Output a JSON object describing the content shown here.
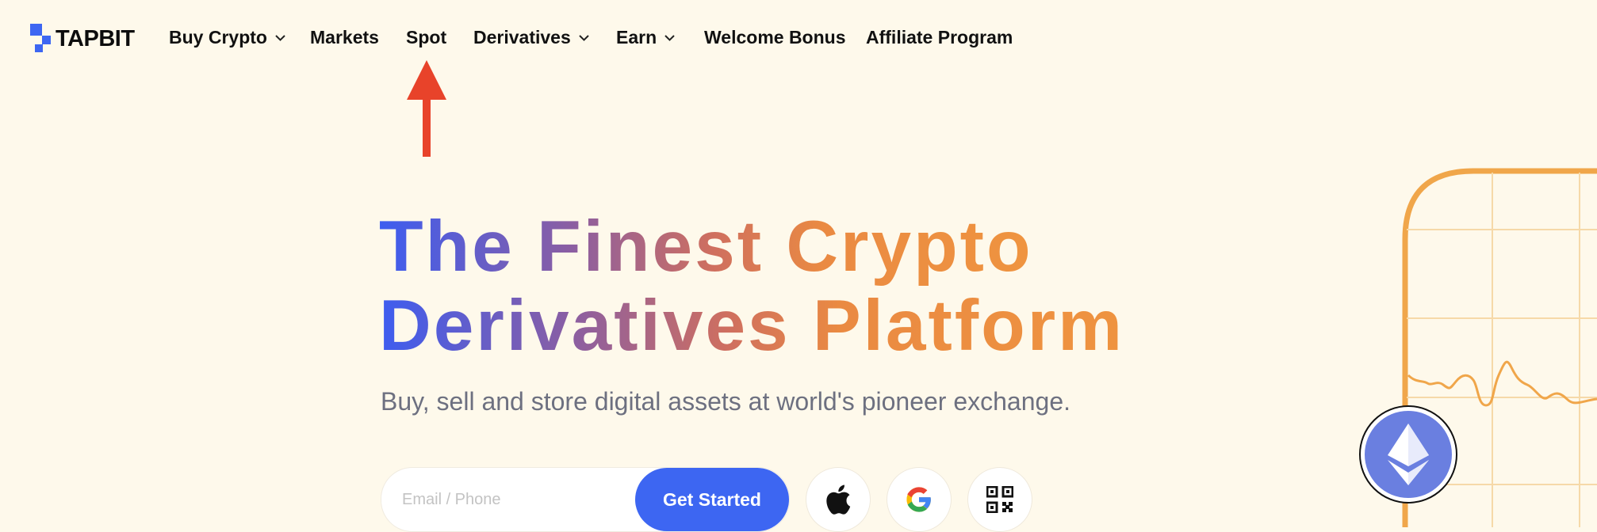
{
  "brand": {
    "name": "TAPBIT"
  },
  "nav": {
    "buy_crypto": "Buy Crypto",
    "markets": "Markets",
    "spot": "Spot",
    "derivatives": "Derivatives",
    "earn": "Earn",
    "welcome_bonus": "Welcome Bonus",
    "affiliate_program": "Affiliate Program"
  },
  "hero": {
    "title_line1": "The Finest Crypto",
    "title_line2": "Derivatives Platform",
    "subtitle": "Buy, sell and store digital assets at world's pioneer exchange."
  },
  "signup": {
    "placeholder": "Email / Phone",
    "cta_label": "Get Started"
  },
  "icons": {
    "logo": "tapbit-logo-icon",
    "chevron": "chevron-down-icon",
    "annotation": "red-arrow-icon",
    "apple": "apple-icon",
    "google": "google-icon",
    "qr": "qr-code-icon",
    "eth": "ethereum-icon"
  },
  "colors": {
    "background": "#fef9eb",
    "accent_blue": "#3d66f2",
    "gradient_start": "#3d5df0",
    "gradient_end": "#ef9440",
    "annotation_red": "#e8432a",
    "chart_orange": "#f0a64a"
  }
}
